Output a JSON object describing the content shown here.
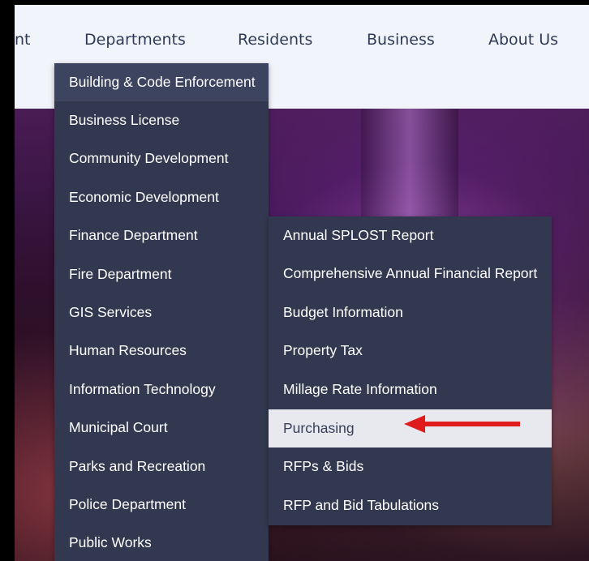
{
  "nav": {
    "partial_label": "nt",
    "items": [
      "Departments",
      "Residents",
      "Business",
      "About Us"
    ]
  },
  "departments_menu": [
    "Building & Code Enforcement",
    "Business License",
    "Community Development",
    "Economic Development",
    "Finance Department",
    "Fire Department",
    "GIS Services",
    "Human Resources",
    "Information Technology",
    "Municipal Court",
    "Parks and Recreation",
    "Police Department",
    "Public Works"
  ],
  "finance_submenu": [
    "Annual SPLOST Report",
    "Comprehensive Annual Financial Report",
    "Budget Information",
    "Property Tax",
    "Millage Rate Information",
    "Purchasing",
    "RFPs & Bids",
    "RFP and Bid Tabulations"
  ],
  "colors": {
    "nav_bg": "#f1f4fb",
    "nav_text": "#2e3b57",
    "menu_bg": "#32384f",
    "menu_highlight": "#e7e9ef",
    "arrow": "#e01b1b"
  },
  "annotation": {
    "type": "red-arrow",
    "points_to": "Purchasing"
  }
}
